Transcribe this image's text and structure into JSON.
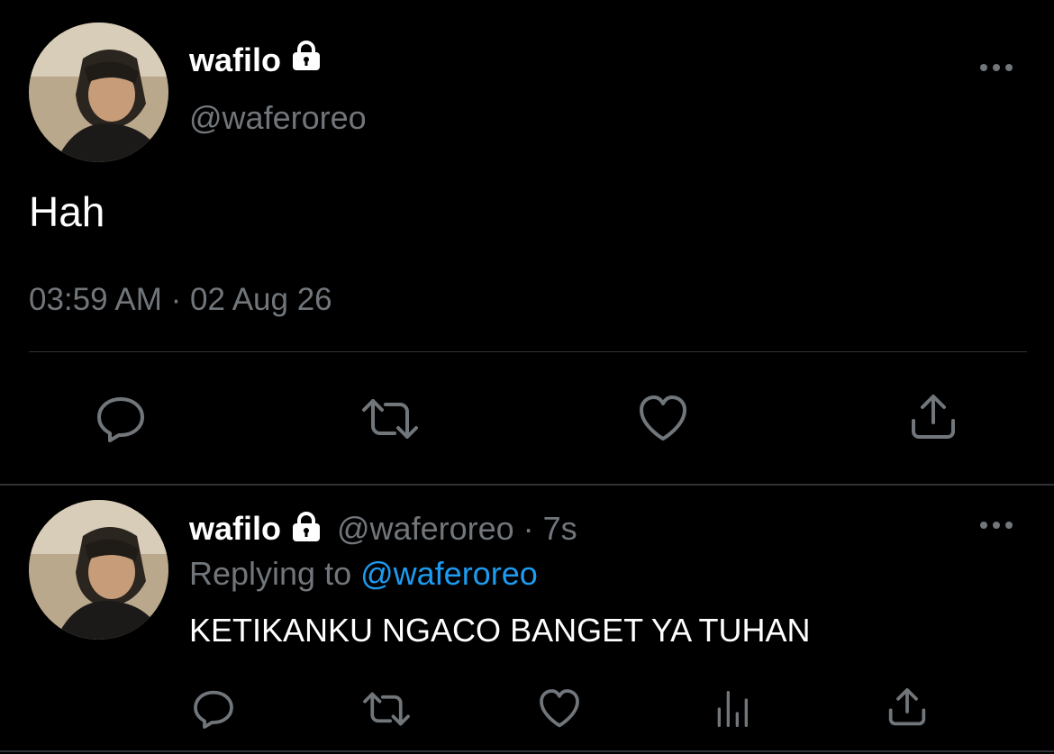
{
  "main_tweet": {
    "display_name": "wafilo",
    "handle": "@waferoreo",
    "text": "Hah",
    "timestamp": "03:59 AM · 02 Aug 26"
  },
  "reply_tweet": {
    "display_name": "wafilo",
    "handle_time": "@waferoreo · 7s",
    "replying_prefix": "Replying to ",
    "replying_to": "@waferoreo",
    "text": "KETIKANKU NGACO BANGET YA TUHAN"
  },
  "icons": {
    "lock": "lock-icon",
    "more": "more-icon",
    "reply": "reply-icon",
    "retweet": "retweet-icon",
    "like": "heart-icon",
    "share": "share-icon",
    "analytics": "analytics-icon"
  },
  "colors": {
    "background": "#000000",
    "text_primary": "#ffffff",
    "text_secondary": "#71767b",
    "accent": "#1d9bf0",
    "divider": "#2f3336"
  }
}
